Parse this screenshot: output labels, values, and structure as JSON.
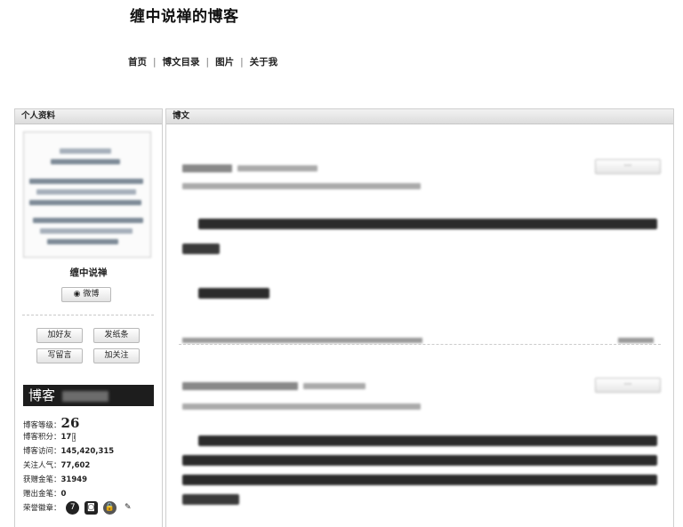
{
  "blog": {
    "title": "缠中说禅的博客"
  },
  "nav": [
    {
      "label": "首页"
    },
    {
      "label": "博文目录"
    },
    {
      "label": "图片"
    },
    {
      "label": "关于我"
    }
  ],
  "sidebar": {
    "header": "个人资料",
    "name": "缠中说禅",
    "weibo_label": "微博",
    "buttons": [
      "加好友",
      "发纸条",
      "写留言",
      "加关注"
    ],
    "brand": "博客",
    "stats": [
      {
        "label": "博客等级：",
        "value": "26"
      },
      {
        "label": "博客积分：",
        "value": "17"
      },
      {
        "label": "博客访问：",
        "value": "145,420,315"
      },
      {
        "label": "关注人气：",
        "value": "77,602"
      },
      {
        "label": "获赠金笔：",
        "value": "31949"
      },
      {
        "label": "赠出金笔：",
        "value": "0"
      },
      {
        "label": "荣誉徽章：",
        "value": ""
      }
    ]
  },
  "main": {
    "header": "博文"
  }
}
